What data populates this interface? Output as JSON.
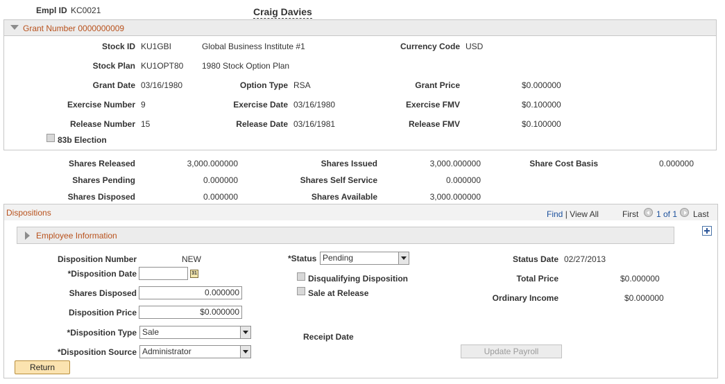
{
  "header": {
    "empl_id_label": "Empl ID",
    "empl_id_value": "KC0021",
    "employee_name": "Craig Davies"
  },
  "grant": {
    "header": "Grant Number 0000000009",
    "stock_id_label": "Stock ID",
    "stock_id_value": "KU1GBI",
    "stock_id_desc": "Global Business Institute #1",
    "currency_code_label": "Currency Code",
    "currency_code_value": "USD",
    "stock_plan_label": "Stock Plan",
    "stock_plan_value": "KU1OPT80",
    "stock_plan_desc": "1980 Stock Option Plan",
    "grant_date_label": "Grant Date",
    "grant_date_value": "03/16/1980",
    "option_type_label": "Option Type",
    "option_type_value": "RSA",
    "grant_price_label": "Grant Price",
    "grant_price_value": "$0.000000",
    "exercise_number_label": "Exercise Number",
    "exercise_number_value": "9",
    "exercise_date_label": "Exercise Date",
    "exercise_date_value": "03/16/1980",
    "exercise_fmv_label": "Exercise FMV",
    "exercise_fmv_value": "$0.100000",
    "release_number_label": "Release Number",
    "release_number_value": "15",
    "release_date_label": "Release Date",
    "release_date_value": "03/16/1981",
    "release_fmv_label": "Release FMV",
    "release_fmv_value": "$0.100000",
    "election_83b_label": "83b Election"
  },
  "shares": {
    "released_label": "Shares Released",
    "released_value": "3,000.000000",
    "issued_label": "Shares Issued",
    "issued_value": "3,000.000000",
    "cost_basis_label": "Share Cost Basis",
    "cost_basis_value": "0.000000",
    "pending_label": "Shares Pending",
    "pending_value": "0.000000",
    "self_service_label": "Shares Self Service",
    "self_service_value": "0.000000",
    "disposed_label": "Shares Disposed",
    "disposed_value": "0.000000",
    "available_label": "Shares Available",
    "available_value": "3,000.000000"
  },
  "dispositions": {
    "title": "Dispositions",
    "find_label": "Find",
    "separator": "|",
    "view_all_label": "View All",
    "first_label": "First",
    "pager_text": "1 of 1",
    "last_label": "Last",
    "employee_info_label": "Employee Information",
    "disposition_number_label": "Disposition Number",
    "disposition_number_value": "NEW",
    "status_label": "*Status",
    "status_value": "Pending",
    "status_date_label": "Status Date",
    "status_date_value": "02/27/2013",
    "disposition_date_label": "*Disposition Date",
    "disposition_date_value": "",
    "calendar_icon_text": "31",
    "disqualifying_label": "Disqualifying Disposition",
    "total_price_label": "Total Price",
    "total_price_value": "$0.000000",
    "shares_disposed_label": "Shares Disposed",
    "shares_disposed_value": "0.000000",
    "sale_at_release_label": "Sale at Release",
    "ordinary_income_label": "Ordinary Income",
    "ordinary_income_value": "$0.000000",
    "disposition_price_label": "Disposition Price",
    "disposition_price_value": "$0.000000",
    "disposition_type_label": "*Disposition Type",
    "disposition_type_value": "Sale",
    "receipt_date_label": "Receipt Date",
    "disposition_source_label": "*Disposition Source",
    "disposition_source_value": "Administrator",
    "update_payroll_label": "Update Payroll"
  },
  "footer": {
    "return_label": "Return"
  },
  "colors": {
    "header_orange": "#b8511c",
    "link_blue": "#1a4f9c",
    "panel_bg": "#ececec",
    "return_button_bg": "#fbe3b0"
  }
}
